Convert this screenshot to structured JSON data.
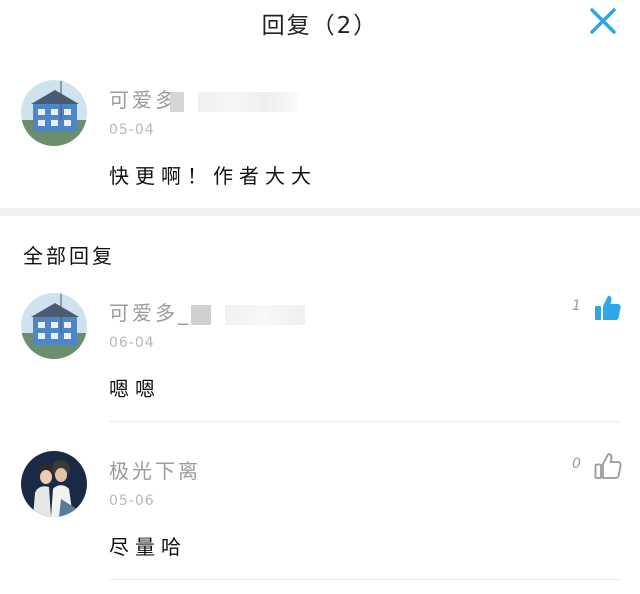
{
  "header": {
    "title": "回复（2）",
    "close_icon": "close-icon",
    "accent_color": "#2ea7e8"
  },
  "main_comment": {
    "avatar": "house-photo-avatar",
    "name": "可爱多",
    "date": "05-04",
    "text": "快更啊！作者大大"
  },
  "replies_section": {
    "title": "全部回复"
  },
  "replies": [
    {
      "avatar": "house-photo-avatar",
      "name": "可爱多_",
      "date": "06-04",
      "text": "嗯嗯",
      "likes": "1",
      "liked": true,
      "like_icon": "thumbs-up-filled-icon"
    },
    {
      "avatar": "couple-photo-avatar",
      "name": "极光下离",
      "date": "05-06",
      "text": "尽量哈",
      "likes": "0",
      "liked": false,
      "like_icon": "thumbs-up-outline-icon"
    }
  ]
}
